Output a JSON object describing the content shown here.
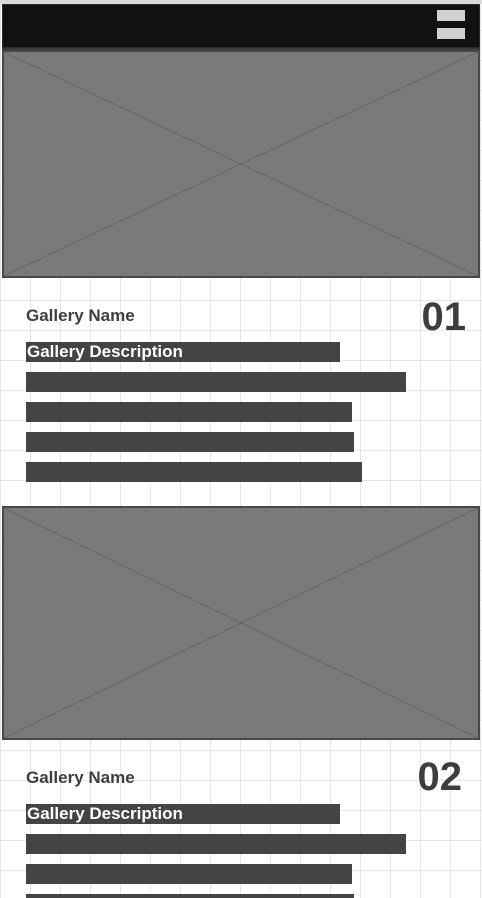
{
  "navbar": {
    "menu_icon": "hamburger-menu-icon",
    "background": "#111111"
  },
  "galleries": [
    {
      "name": "Gallery Name",
      "number": "01",
      "description_label": "Gallery Description",
      "image_icon": "image-placeholder-icon"
    },
    {
      "name": "Gallery Name",
      "number": "02",
      "description_label": "Gallery Description",
      "image_icon": "image-placeholder-icon"
    }
  ],
  "colors": {
    "placeholder_fill": "#7a7a7a",
    "text_block": "#444444",
    "heading_text": "#3e3e3e"
  }
}
